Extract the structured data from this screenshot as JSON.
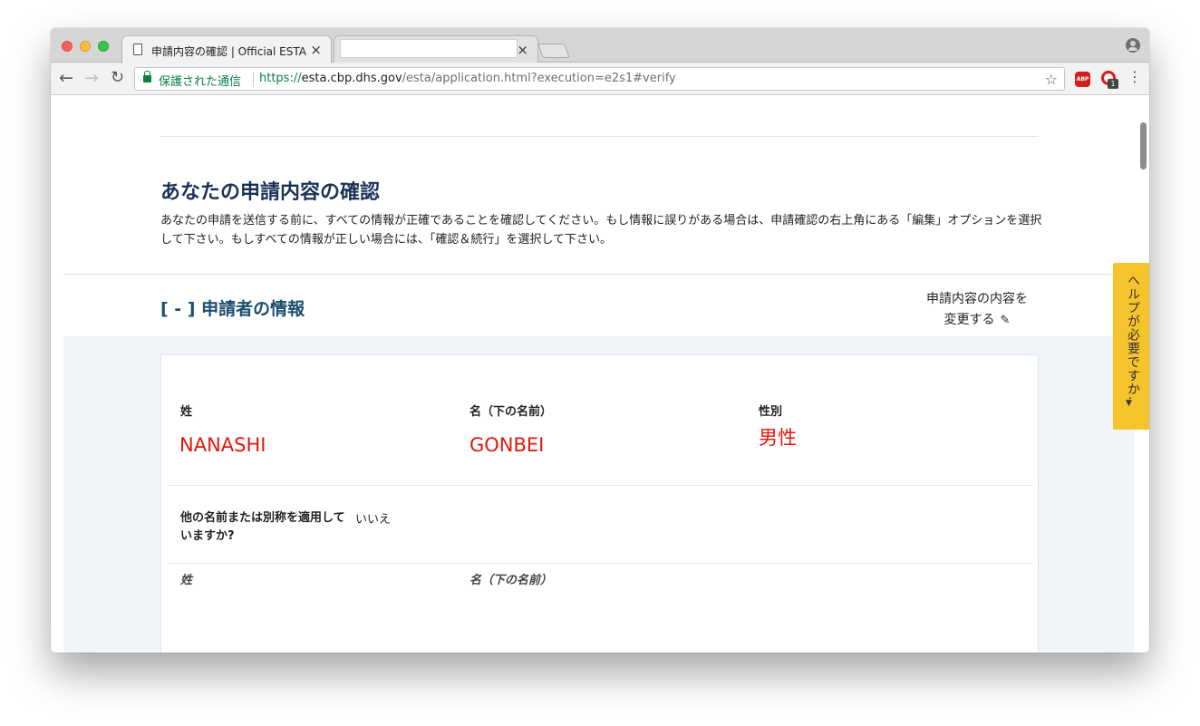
{
  "browser": {
    "active_tab_title": "申請内容の確認 | Official ESTA",
    "inactive_tab_title": "",
    "tab_close": "×",
    "secure_label": "保護された通信",
    "url_scheme": "https://",
    "url_host": "esta.cbp.dhs.gov",
    "url_path": "/esta/application.html?execution=e2s1#verify",
    "abp_label": "ABP",
    "ext_badge": "1"
  },
  "page": {
    "title": "あなたの申請内容の確認",
    "description": "あなたの申請を送信する前に、すべての情報が正確であることを確認してください。もし情報に誤りがある場合は、申請確認の右上角にある「編集」オプションを選択して下さい。もしすべての情報が正しい場合には、「確認＆続行」を選択して下さい。"
  },
  "section": {
    "title": "[ - ] 申請者の情報",
    "edit_line1": "申請内容の内容を",
    "edit_line2": "変更する",
    "surname_label": "姓",
    "surname_value": "NANASHI",
    "given_label": "名（下の名前）",
    "given_value": "GONBEI",
    "gender_label": "性別",
    "gender_value": "男性",
    "alias_question": "他の名前または別称を適用していますか?",
    "alias_answer": "いいえ",
    "alias_surname_label": "姓",
    "alias_given_label": "名（下の名前）"
  },
  "help": {
    "label": "ヘルプが必要ですか.",
    "caret": "▼"
  },
  "colors": {
    "title": "#1b3258",
    "section_title": "#1b4e6f",
    "value_red": "#e3170d",
    "help_bg": "#f5c32b",
    "secure_green": "#0b8043"
  }
}
